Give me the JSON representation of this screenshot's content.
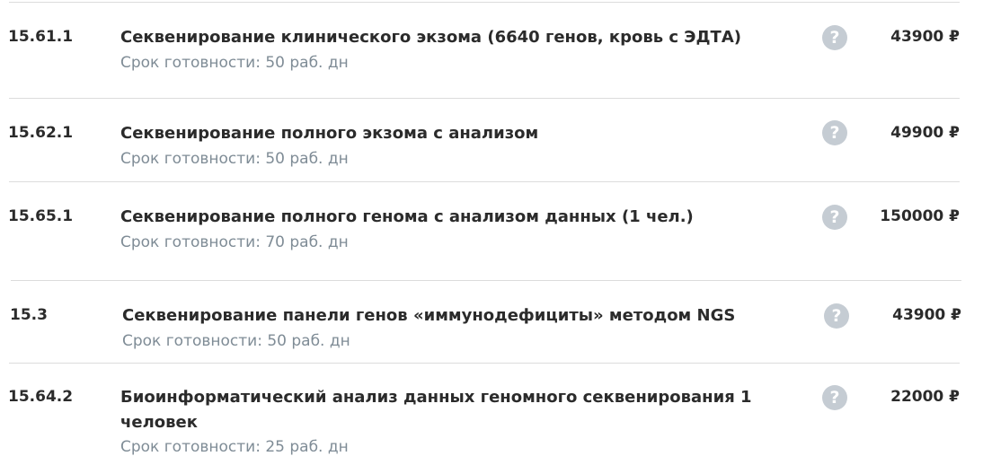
{
  "services": [
    {
      "code": "15.61.1",
      "name": "Секвенирование клинического экзома (6640 генов, кровь с ЭДТА)",
      "term": "Срок готовности: 50 раб. дн",
      "price": "43900 ₽",
      "help_icon": "question-circle-icon"
    },
    {
      "code": "15.62.1",
      "name": "Секвенирование полного экзома с анализом",
      "term": "Срок готовности: 50 раб. дн",
      "price": "49900 ₽",
      "help_icon": "question-circle-icon"
    },
    {
      "code": "15.65.1",
      "name": "Секвенирование полного генома с анализом данных (1 чел.)",
      "term": "Срок готовности: 70 раб. дн",
      "price": "150000 ₽",
      "help_icon": "question-circle-icon"
    },
    {
      "code": "15.3",
      "name": "Секвенирование панели генов «иммунодефициты» методом NGS",
      "term": "Срок готовности: 50 раб. дн",
      "price": "43900 ₽",
      "help_icon": "question-circle-icon"
    },
    {
      "code": "15.64.2",
      "name": "Биоинформатический анализ данных геномного секвенирования 1 человек",
      "term": "Срок готовности: 25 раб. дн",
      "price": "22000 ₽",
      "help_icon": "question-circle-icon"
    }
  ],
  "help_glyph": "?",
  "colors": {
    "text": "#2b2b2b",
    "muted": "#7f8c96",
    "help_icon_bg": "#c5ccd3",
    "divider": "#dcdcdc"
  }
}
